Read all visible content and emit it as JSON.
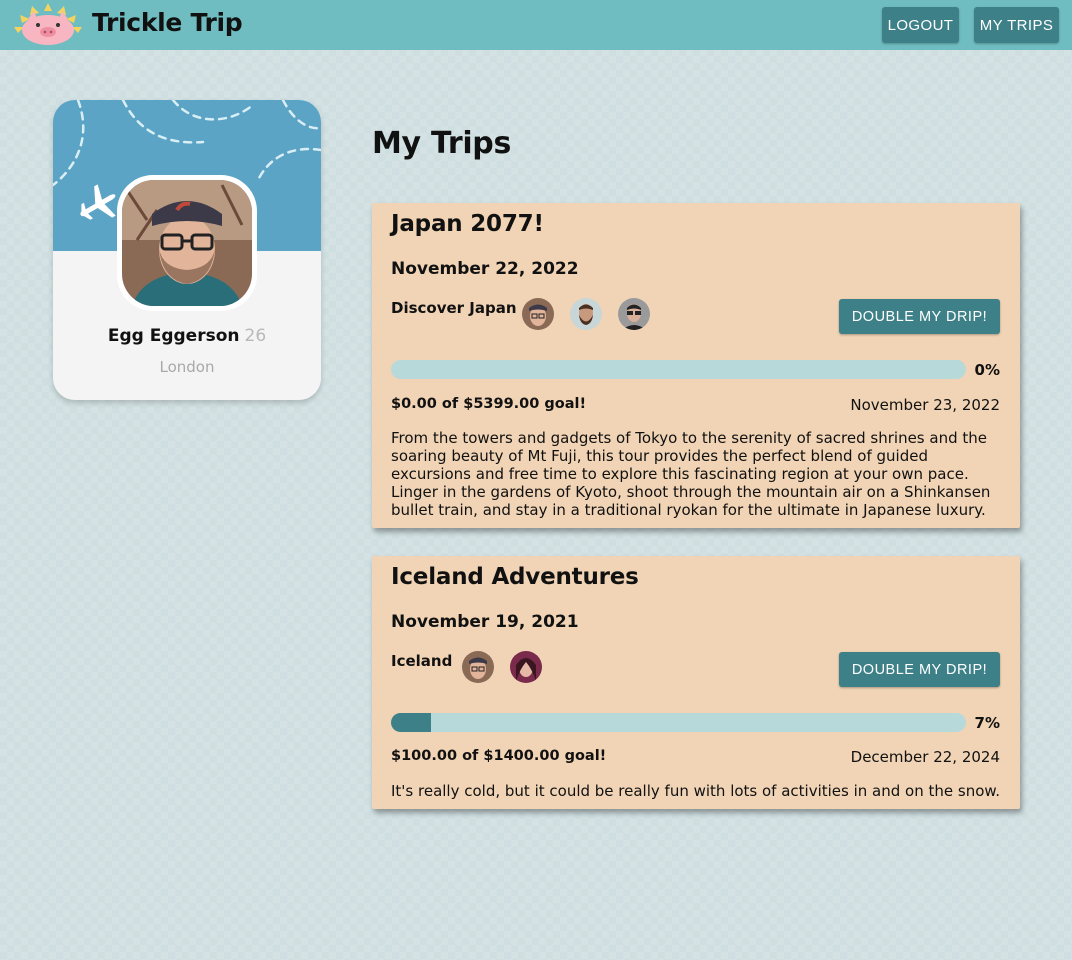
{
  "header": {
    "brand": "Trickle Trip",
    "logout_label": "LOGOUT",
    "mytrips_label": "MY TRIPS"
  },
  "profile": {
    "name": "Egg Eggerson",
    "age": "26",
    "city": "London"
  },
  "page_title": "My Trips",
  "trips": [
    {
      "title": "Japan 2077!",
      "date": "November 22, 2022",
      "destination": "Discover Japan",
      "button_label": "DOUBLE MY DRIP!",
      "progress": 0,
      "progress_label": "0%",
      "goal_text": "$0.00 of $5399.00 goal!",
      "target_date": "November 23, 2022",
      "description": "From the towers and gadgets of Tokyo to the serenity of sacred shrines and the soaring beauty of Mt Fuji, this tour provides the perfect blend of guided excursions and free time to explore this fascinating region at your own pace. Linger in the gardens of Kyoto, shoot through the mountain air on a Shinkansen bullet train, and stay in a traditional ryokan for the ultimate in Japanese luxury."
    },
    {
      "title": "Iceland Adventures",
      "date": "November 19, 2021",
      "destination": "Iceland",
      "button_label": "DOUBLE MY DRIP!",
      "progress": 0.07,
      "progress_label": "7%",
      "goal_text": "$100.00 of $1400.00 goal!",
      "target_date": "December 22, 2024",
      "description": "It's really cold, but it could be really fun with lots of activities in and on the snow."
    }
  ],
  "colors": {
    "header": "#6fbdc1",
    "button": "#3d8088",
    "card": "#f1d4b5",
    "progress_track": "#b8d9da",
    "progress_fill": "#3d8088",
    "banner": "#5ba4c5"
  }
}
